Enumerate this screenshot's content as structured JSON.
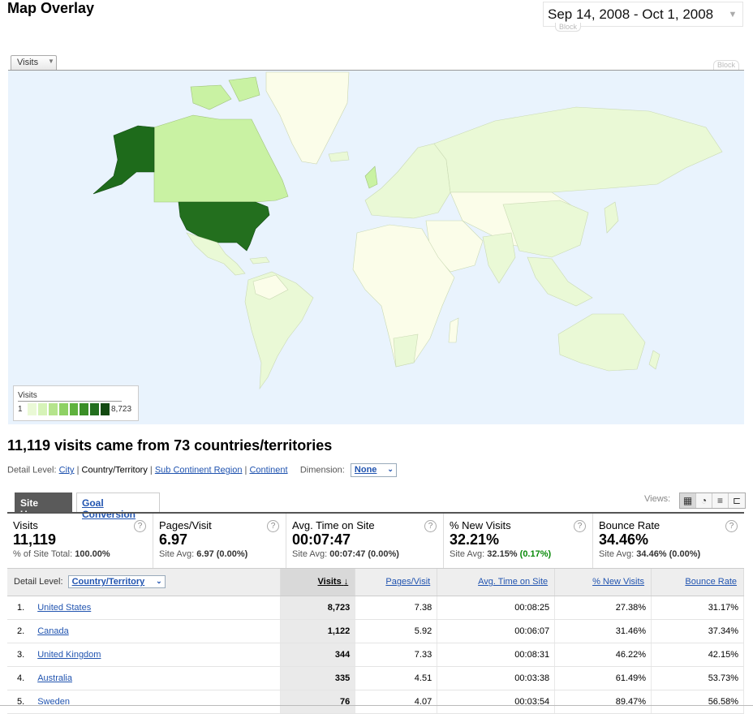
{
  "page": {
    "title": "Map Overlay",
    "date_range": "Sep 14, 2008 - Oct 1, 2008",
    "block_label": "Block"
  },
  "map": {
    "metric_select": "Visits",
    "legend": {
      "label": "Visits",
      "min": "1",
      "max": "8,723"
    },
    "colors": {
      "ocean": "#e9f3fd",
      "none": "#fbfde9",
      "low": "#eaf9d6",
      "mid": "#c9f2a3",
      "high": "#1e6b1b",
      "top": "#236f1e"
    }
  },
  "summary_headline": "11,119 visits came from 73 countries/territories",
  "detail": {
    "label": "Detail Level:",
    "levels": [
      "City",
      "Country/Territory",
      "Sub Continent Region",
      "Continent"
    ],
    "dimension_label": "Dimension:",
    "dimension_value": "None"
  },
  "tabs": [
    "Site Usage",
    "Goal Conversion"
  ],
  "views_label": "Views:",
  "summary": [
    {
      "name": "Visits",
      "value": "11,119",
      "sub_prefix": "% of Site Total:",
      "sub_value": "100.00%",
      "sub_delta": ""
    },
    {
      "name": "Pages/Visit",
      "value": "6.97",
      "sub_prefix": "Site Avg:",
      "sub_value": "6.97 (0.00%)",
      "sub_delta": ""
    },
    {
      "name": "Avg. Time on Site",
      "value": "00:07:47",
      "sub_prefix": "Site Avg:",
      "sub_value": "00:07:47 (0.00%)",
      "sub_delta": ""
    },
    {
      "name": "% New Visits",
      "value": "32.21%",
      "sub_prefix": "Site Avg:",
      "sub_value": "32.15%",
      "sub_delta": "(0.17%)"
    },
    {
      "name": "Bounce Rate",
      "value": "34.46%",
      "sub_prefix": "Site Avg:",
      "sub_value": "34.46% (0.00%)",
      "sub_delta": ""
    }
  ],
  "table": {
    "detail_label": "Detail Level:",
    "detail_value": "Country/Territory",
    "columns": [
      "Visits",
      "Pages/Visit",
      "Avg. Time on Site",
      "% New Visits",
      "Bounce Rate"
    ],
    "rows": [
      {
        "n": "1.",
        "country": "United States",
        "visits": "8,723",
        "ppv": "7.38",
        "time": "00:08:25",
        "new": "27.38%",
        "bounce": "31.17%"
      },
      {
        "n": "2.",
        "country": "Canada",
        "visits": "1,122",
        "ppv": "5.92",
        "time": "00:06:07",
        "new": "31.46%",
        "bounce": "37.34%"
      },
      {
        "n": "3.",
        "country": "United Kingdom",
        "visits": "344",
        "ppv": "7.33",
        "time": "00:08:31",
        "new": "46.22%",
        "bounce": "42.15%"
      },
      {
        "n": "4.",
        "country": "Australia",
        "visits": "335",
        "ppv": "4.51",
        "time": "00:03:38",
        "new": "61.49%",
        "bounce": "53.73%"
      },
      {
        "n": "5.",
        "country": "Sweden",
        "visits": "76",
        "ppv": "4.07",
        "time": "00:03:54",
        "new": "89.47%",
        "bounce": "56.58%"
      }
    ]
  }
}
